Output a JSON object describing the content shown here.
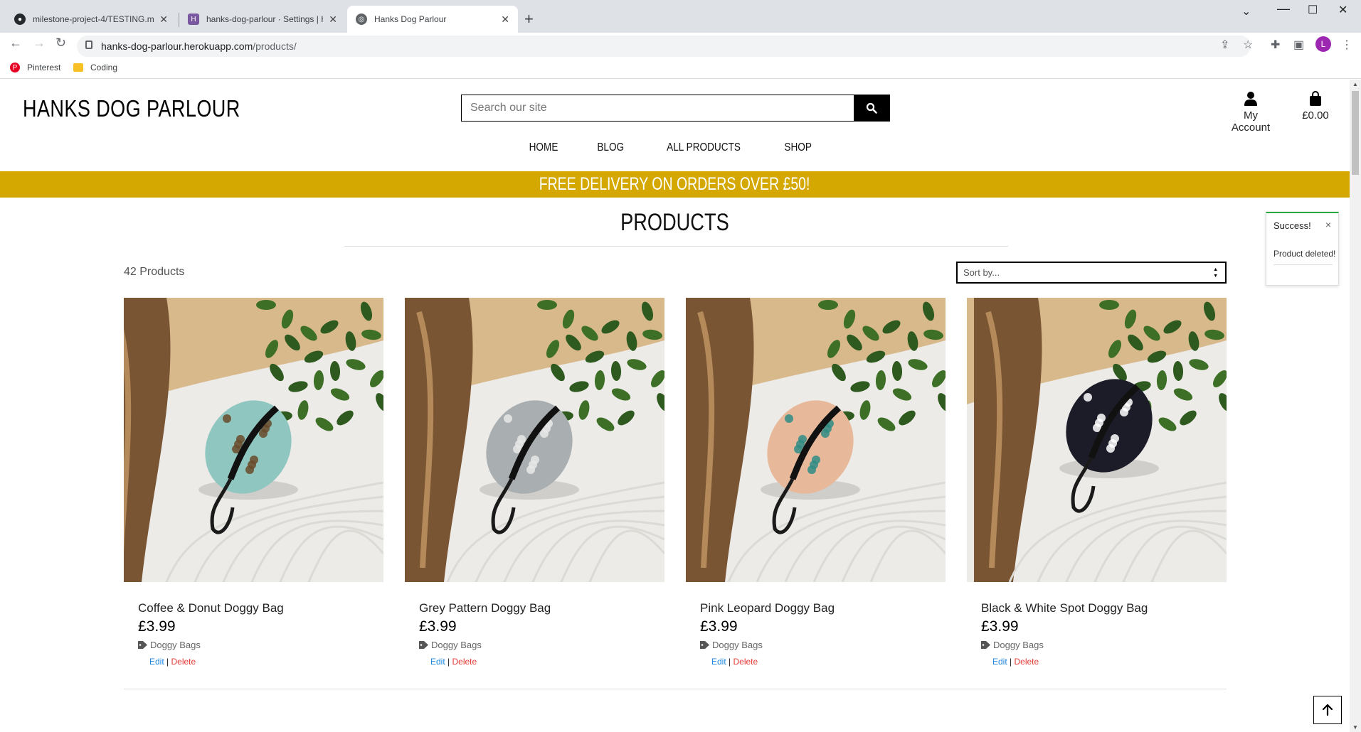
{
  "browser": {
    "tabs": [
      {
        "title": "milestone-project-4/TESTING.md",
        "active": false
      },
      {
        "title": "hanks-dog-parlour · Settings | He",
        "active": false
      },
      {
        "title": "Hanks Dog Parlour",
        "active": true
      }
    ],
    "url_domain": "hanks-dog-parlour.herokuapp.com",
    "url_path": "/products/",
    "profile_initial": "L",
    "bookmarks": [
      {
        "label": "Pinterest"
      },
      {
        "label": "Coding"
      }
    ]
  },
  "site": {
    "brand": "HANKS DOG PARLOUR",
    "search_placeholder": "Search our site",
    "account_label": "My Account",
    "bag_total": "£0.00",
    "nav": [
      "HOME",
      "BLOG",
      "ALL PRODUCTS",
      "SHOP"
    ],
    "banner": "FREE DELIVERY ON ORDERS OVER £50!",
    "page_title": "PRODUCTS",
    "product_count": "42 Products",
    "sort_label": "Sort by..."
  },
  "toast": {
    "title": "Success!",
    "message": "Product deleted!",
    "close": "×"
  },
  "products": [
    {
      "name": "Coffee & Donut Doggy Bag",
      "price": "£3.99",
      "category": "Doggy Bags",
      "edit": "Edit",
      "delete": "Delete",
      "bag_color": "#8fc7c0",
      "pattern": "#6a4a2a"
    },
    {
      "name": "Grey Pattern Doggy Bag",
      "price": "£3.99",
      "category": "Doggy Bags",
      "edit": "Edit",
      "delete": "Delete",
      "bag_color": "#a9aeb0",
      "pattern": "#e8e8e8"
    },
    {
      "name": "Pink Leopard Doggy Bag",
      "price": "£3.99",
      "category": "Doggy Bags",
      "edit": "Edit",
      "delete": "Delete",
      "bag_color": "#e7b99a",
      "pattern": "#2f8c85"
    },
    {
      "name": "Black & White Spot Doggy Bag",
      "price": "£3.99",
      "category": "Doggy Bags",
      "edit": "Edit",
      "delete": "Delete",
      "bag_color": "#1c1c28",
      "pattern": "#ffffff"
    }
  ],
  "colors": {
    "banner": "#d4a800",
    "toast_accent": "#28a745",
    "edit_link": "#1e88e5",
    "delete_link": "#e53935"
  }
}
